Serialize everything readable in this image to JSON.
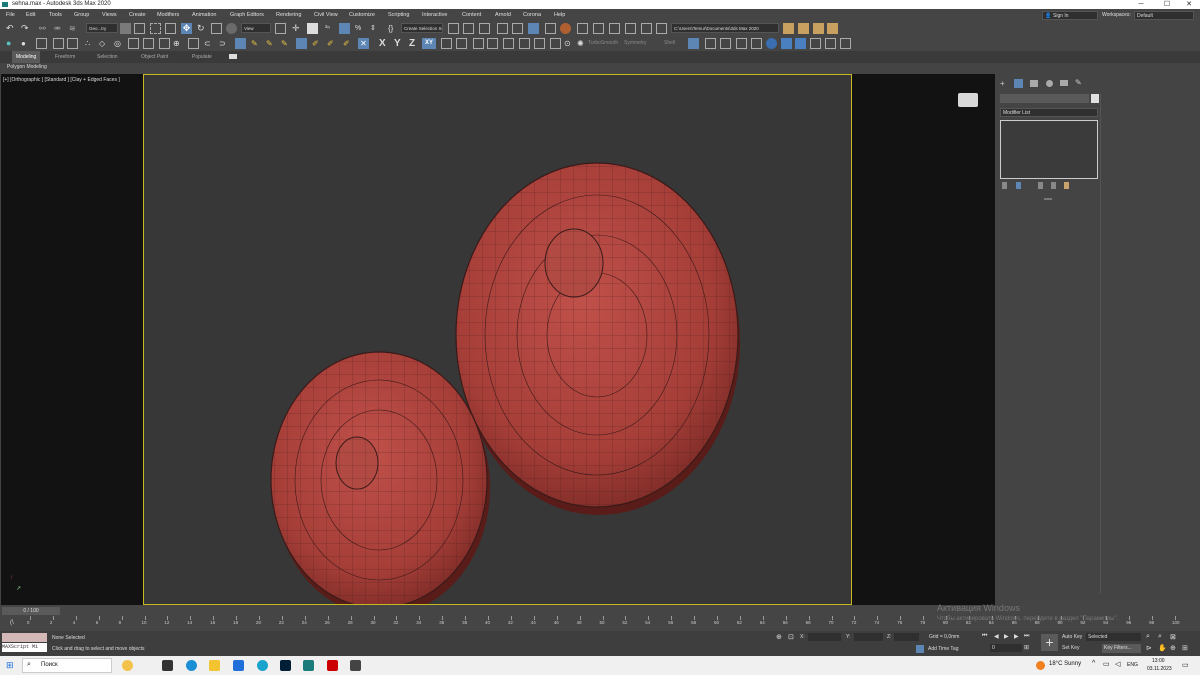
{
  "window": {
    "title": "sehna.max - Autodesk 3ds Max 2020"
  },
  "menu": [
    "File",
    "Edit",
    "Tools",
    "Group",
    "Views",
    "Create",
    "Modifiers",
    "Animation",
    "Graph Editors",
    "Rendering",
    "Civil View",
    "Customize",
    "Scripting",
    "Interactive",
    "Content",
    "Arnold",
    "Corona",
    "Help"
  ],
  "account": {
    "sign_in": "Sign In",
    "workspaces_label": "Workspaces:",
    "workspace": "Default"
  },
  "toolbar": {
    "selection_filter": "Geo...try",
    "ref_coord": "View",
    "named_selection": "Create Selection Se",
    "project_path": "C:\\Users\\Temur\\Documents\\3ds Max 2020",
    "axis_x": "X",
    "axis_y": "Y",
    "axis_z": "Z",
    "axis_xy": "XY",
    "turbosmooth": "TurboSmooth",
    "symmetry": "Symmetry",
    "shell": "Shell"
  },
  "ribbon": {
    "tabs": [
      "Modeling",
      "Freeform",
      "Selection",
      "Object Paint",
      "Populate"
    ],
    "panel": "Polygon Modeling"
  },
  "viewport": {
    "label": "[+] [Orthographic ] [Standard ] [Clay + Edged Faces ]"
  },
  "command_panel": {
    "modifier_list": "Modifier List"
  },
  "timeline": {
    "frame": "0 / 100",
    "ticks": [
      "0",
      "2",
      "4",
      "6",
      "8",
      "10",
      "12",
      "14",
      "16",
      "18",
      "20",
      "22",
      "24",
      "26",
      "28",
      "30",
      "32",
      "34",
      "36",
      "38",
      "40",
      "42",
      "44",
      "46",
      "48",
      "50",
      "52",
      "54",
      "56",
      "58",
      "60",
      "62",
      "64",
      "66",
      "68",
      "70",
      "72",
      "74",
      "76",
      "78",
      "80",
      "82",
      "84",
      "86",
      "88",
      "90",
      "92",
      "94",
      "96",
      "98",
      "100"
    ]
  },
  "status": {
    "maxscript": "MAXScript Mi",
    "selection": "None Selected",
    "prompt": "Click and drag to select and move objects",
    "x_label": "X:",
    "y_label": "Y:",
    "z_label": "Z:",
    "grid": "Grid = 0,0mm",
    "add_time_tag": "Add Time Tag",
    "auto_key": "Auto Key",
    "selected": "Selected",
    "set_key": "Set Key",
    "key_filters": "Key Filters...",
    "frame_field": "0"
  },
  "watermark": {
    "title": "Активация Windows",
    "sub": "Чтобы активировать Windows, перейдите в раздел \"Параметры\"."
  },
  "taskbar": {
    "search": "Поиск",
    "weather": "18°C  Sunny",
    "lang": "ENG",
    "time": "13:00",
    "date": "03.11.2023"
  }
}
